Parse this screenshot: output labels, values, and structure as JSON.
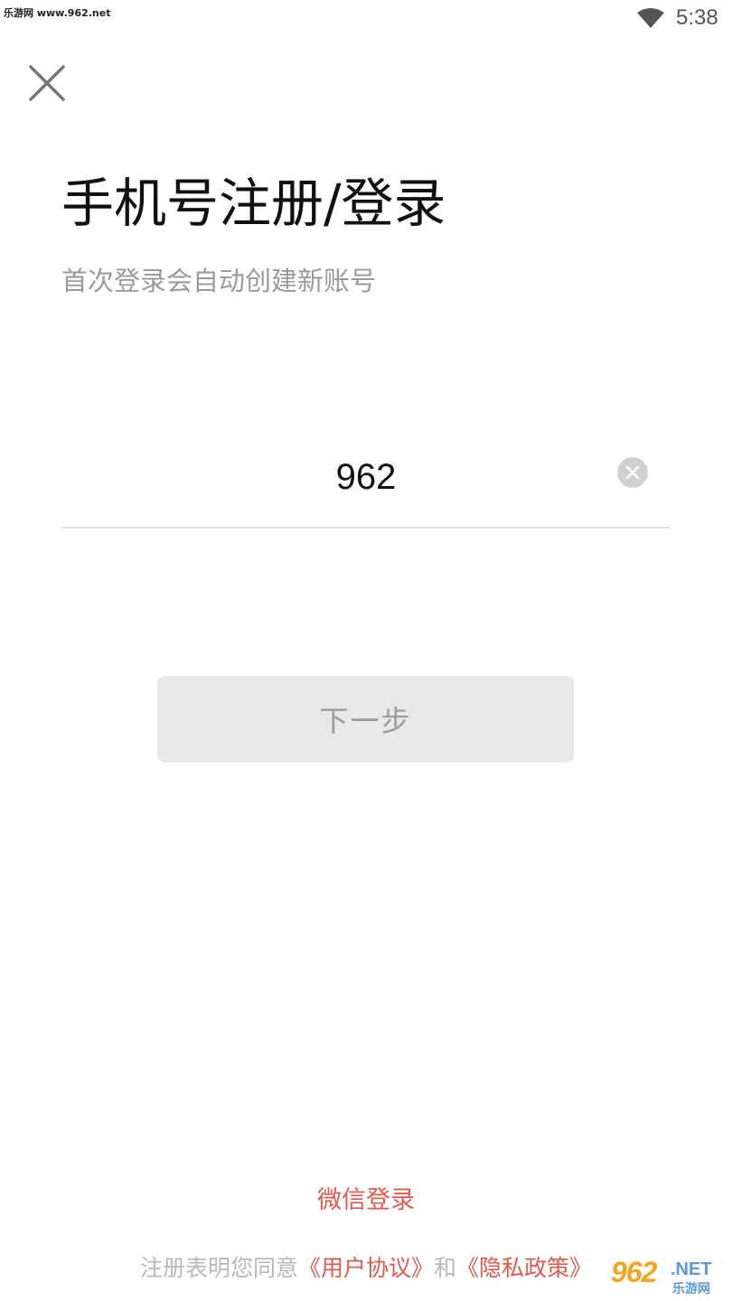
{
  "status_bar": {
    "watermark": "乐游网 www.962.net",
    "time": "5:38",
    "wifi_icon": "wifi-icon"
  },
  "close_icon": "close-icon",
  "header": {
    "title": "手机号注册/登录",
    "subtitle": "首次登录会自动创建新账号"
  },
  "phone_input": {
    "value": "962",
    "clear_icon": "clear-circle-icon"
  },
  "next_button": {
    "label": "下一步"
  },
  "footer": {
    "wechat_login": "微信登录",
    "agreement_prefix": "注册表明您同意",
    "user_agreement": "《用户协议》",
    "and": "和",
    "privacy_policy": "《隐私政策》"
  },
  "watermark_bottom": {
    "number": "962",
    "suffix": ".NET",
    "cn": "乐游网"
  },
  "colors": {
    "accent": "#e05a4e",
    "title": "#111111",
    "subtitle": "#9a9a9a",
    "button_bg": "#e8e8e8",
    "button_text": "#9c9c9c"
  }
}
